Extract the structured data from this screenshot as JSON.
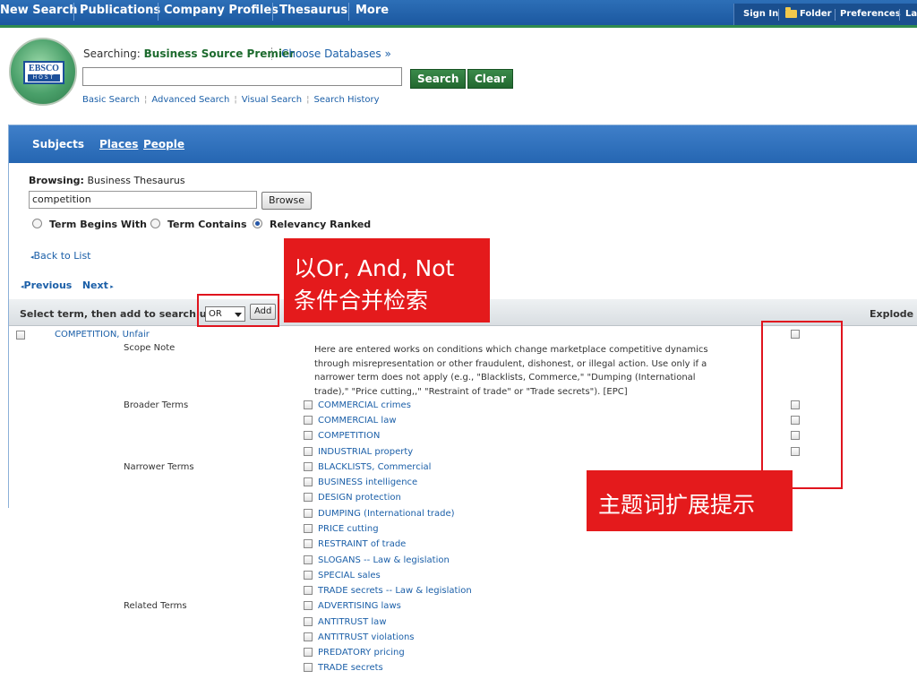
{
  "topnav": {
    "items": [
      "New Search",
      "Publications",
      "Company Profiles",
      "Thesaurus",
      "More"
    ],
    "utility": [
      "Sign In",
      "Folder",
      "Preferences",
      "La"
    ]
  },
  "header": {
    "logo_text_top": "EBSCO",
    "logo_text_bottom": "HOST",
    "searching_label": "Searching:",
    "database": "Business Source Premier",
    "choose_databases": "Choose Databases »",
    "search_value": "",
    "search_button": "Search",
    "clear_button": "Clear",
    "links": [
      "Basic Search",
      "Advanced Search",
      "Visual Search",
      "Search History"
    ]
  },
  "tabs": {
    "subjects": "Subjects",
    "places": "Places",
    "people": "People"
  },
  "browse": {
    "label": "Browsing:",
    "thesaurus": "Business Thesaurus",
    "term_value": "competition",
    "browse_button": "Browse",
    "options": [
      "Term Begins With",
      "Term Contains",
      "Relevancy Ranked"
    ],
    "selected_option": "Relevancy Ranked",
    "back_to_list": "Back to List",
    "previous": "Previous",
    "next": "Next"
  },
  "select_bar": {
    "text": "Select term, then add to search using:",
    "operator": "OR",
    "add_button": "Add",
    "explode": "Explode"
  },
  "term": {
    "name": "COMPETITION",
    "qualifier": "Unfair",
    "scope_label": "Scope Note",
    "scope_text": "Here are entered works on conditions which change marketplace competitive dynamics through misrepresentation or other fraudulent, dishonest, or illegal action. Use only if a narrower term does not apply (e.g., \"Blacklists, Commerce,\" \"Dumping (International trade),\" \"Price cutting,,\" \"Restraint of trade\" or \"Trade secrets\"). [EPC]",
    "broader_label": "Broader Terms",
    "broader": [
      {
        "upper": "COMMERCIAL",
        "lower": "crimes"
      },
      {
        "upper": "COMMERCIAL",
        "lower": "law"
      },
      {
        "upper": "COMPETITION",
        "lower": ""
      },
      {
        "upper": "INDUSTRIAL",
        "lower": "property"
      }
    ],
    "narrower_label": "Narrower Terms",
    "narrower": [
      {
        "upper": "BLACKLISTS,",
        "lower": "Commercial"
      },
      {
        "upper": "BUSINESS",
        "lower": "intelligence"
      },
      {
        "upper": "DESIGN",
        "lower": "protection"
      },
      {
        "upper": "DUMPING",
        "lower": "(International trade)"
      },
      {
        "upper": "PRICE",
        "lower": "cutting"
      },
      {
        "upper": "RESTRAINT",
        "lower": "of trade"
      },
      {
        "upper": "SLOGANS --",
        "lower": "Law & legislation"
      },
      {
        "upper": "SPECIAL",
        "lower": "sales"
      },
      {
        "upper": "TRADE",
        "lower": "secrets -- Law & legislation"
      }
    ],
    "related_label": "Related Terms",
    "related": [
      {
        "upper": "ADVERTISING",
        "lower": "laws"
      },
      {
        "upper": "ANTITRUST",
        "lower": "law"
      },
      {
        "upper": "ANTITRUST",
        "lower": "violations"
      },
      {
        "upper": "PREDATORY",
        "lower": "pricing"
      },
      {
        "upper": "TRADE",
        "lower": "secrets"
      }
    ]
  },
  "annotations": {
    "operator_line1": "以Or, And, Not",
    "operator_line2": "条件合并检索",
    "explode_hint": "主题词扩展提示"
  },
  "colors": {
    "nav_blue": "#1f5fa8",
    "link_blue": "#1b5fa8",
    "green_button": "#2e7a3c",
    "annotation_red": "#e41a1c"
  }
}
